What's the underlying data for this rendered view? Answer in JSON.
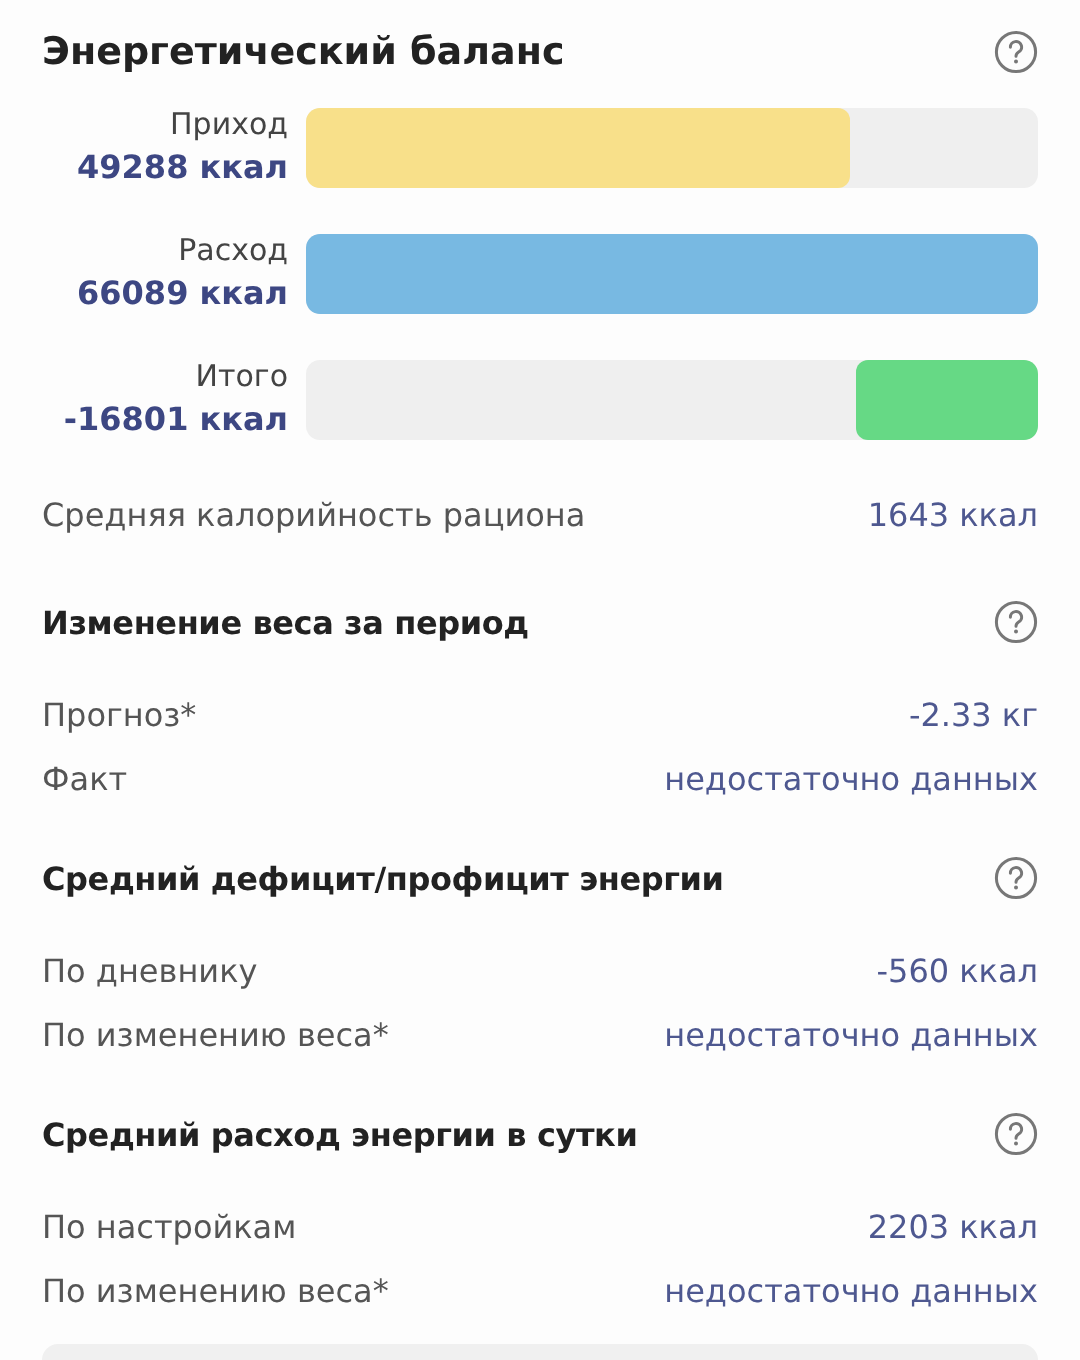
{
  "balance": {
    "title": "Энергетический баланс",
    "bars": [
      {
        "kind": "income",
        "label": "Приход",
        "value": "49288 ккал",
        "level": 0.743
      },
      {
        "kind": "expense",
        "label": "Расход",
        "value": "66089 ккал",
        "level": 1
      },
      {
        "kind": "total",
        "label": "Итого",
        "value": "-16801 ккал",
        "level": 0.25
      }
    ],
    "average": {
      "label": "Средняя калорийность рациона",
      "value": "1643 ккал"
    }
  },
  "sections": [
    {
      "title": "Изменение веса за период",
      "rows": [
        {
          "label": "Прогноз*",
          "value": "-2.33 кг"
        },
        {
          "label": "Факт",
          "value": "недостаточно данных"
        }
      ]
    },
    {
      "title": "Средний дефицит/профицит энергии",
      "rows": [
        {
          "label": "По дневнику",
          "value": "-560 ккал"
        },
        {
          "label": "По изменению веса*",
          "value": "недостаточно данных"
        }
      ]
    },
    {
      "title": "Средний расход энергии в сутки",
      "rows": [
        {
          "label": "По настройкам",
          "value": "2203 ккал"
        },
        {
          "label": "По изменению веса*",
          "value": "недостаточно данных"
        }
      ]
    }
  ]
}
